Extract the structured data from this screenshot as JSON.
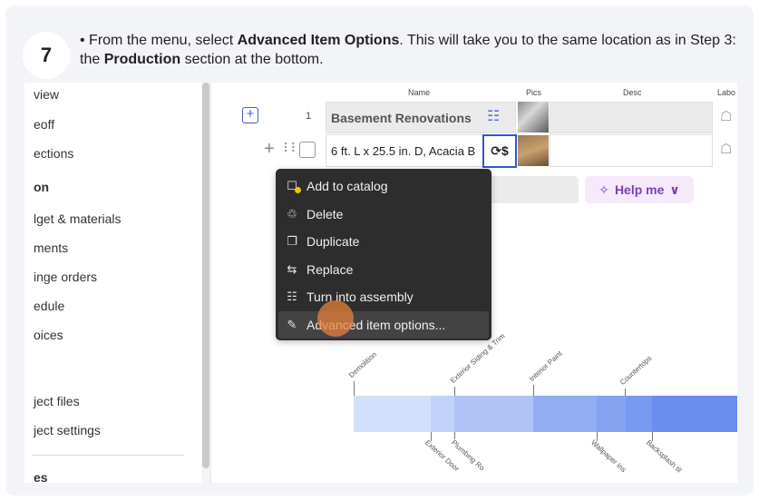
{
  "step": {
    "number": "7",
    "text_parts": [
      "• From the menu, select ",
      "Advanced Item Options",
      ". This will take you to the same location as in Step 3: the ",
      "Production",
      " section at the bottom."
    ]
  },
  "sidebar": {
    "items": [
      "view",
      "eoff",
      "ections",
      "on",
      "lget & materials",
      "ments",
      "inge orders",
      "edule",
      "oices",
      "ject files",
      "ject settings",
      "es"
    ]
  },
  "table": {
    "headers": {
      "name": "Name",
      "pics": "Pics",
      "desc": "Desc",
      "labor": "Labo"
    },
    "rows": [
      {
        "num": "1",
        "name": "Basement Renovations"
      },
      {
        "num": "",
        "name": "6 ft. L x 25.5 in. D, Acacia B"
      }
    ]
  },
  "help_button": {
    "label": "Help me"
  },
  "context_menu": {
    "items": [
      {
        "label": "Add to catalog",
        "icon": "catalog-add-icon"
      },
      {
        "label": "Delete",
        "icon": "trash-icon"
      },
      {
        "label": "Duplicate",
        "icon": "duplicate-icon"
      },
      {
        "label": "Replace",
        "icon": "replace-icon"
      },
      {
        "label": "Turn into assembly",
        "icon": "assembly-icon"
      },
      {
        "label": "Advanced item options...",
        "icon": "pencil-icon"
      }
    ]
  },
  "gantt": {
    "top_labels": [
      "Demolition",
      "Exterior Siding & Trim",
      "Interior Paint",
      "Countertops"
    ],
    "bottom_labels": [
      "Exterior Door",
      "Plumbing Ro",
      "Wallpaper Ins",
      "Backsplash til"
    ],
    "colors": [
      "#d3e0fb",
      "#c2d3fa",
      "#b0c3f7",
      "#93adf3",
      "#86a3f1",
      "#789af0",
      "#6a8ef0"
    ]
  }
}
